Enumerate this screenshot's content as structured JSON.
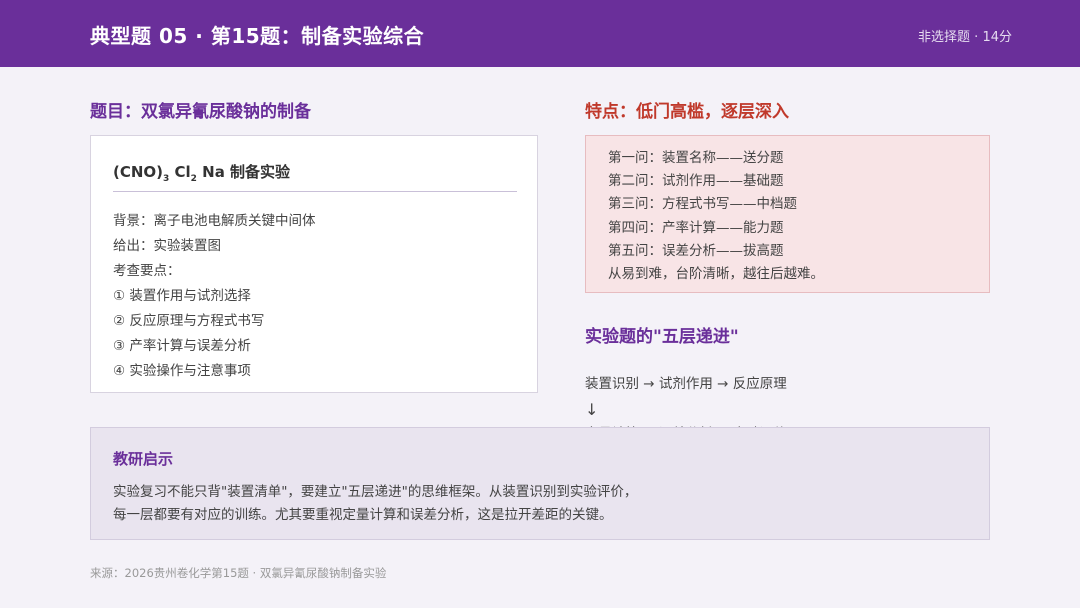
{
  "header": {
    "title": "典型题 05 · 第15题：制备实验综合",
    "meta": "非选择题 · 14分"
  },
  "question": {
    "heading": "题目：双氯异氰尿酸钠的制备",
    "formula_parts": [
      "(CNO)",
      "3",
      " Cl",
      "2",
      " Na 制备实验"
    ],
    "lines": [
      "背景：离子电池电解质关键中间体",
      "给出：实验装置图",
      "考查要点：",
      "① 装置作用与试剂选择",
      "② 反应原理与方程式书写",
      "③ 产率计算与误差分析",
      "④ 实验操作与注意事项"
    ]
  },
  "features": {
    "heading": "特点：低门高槛，逐层深入",
    "lines": [
      "第一问：装置名称——送分题",
      "第二问：试剂作用——基础题",
      "第三问：方程式书写——中档题",
      "第四问：产率计算——能力题",
      "第五问：误差分析——拔高题",
      "从易到难，台阶清晰，越往后越难。"
    ]
  },
  "layers": {
    "heading": "实验题的\"五层递进\"",
    "row1": "装置识别 → 试剂作用 → 反应原理",
    "arrow": "↓",
    "row2": "定量计算 → 误差分析 → 实验评价"
  },
  "insight": {
    "heading": "教研启示",
    "lines": [
      "实验复习不能只背\"装置清单\"，要建立\"五层递进\"的思维框架。从装置识别到实验评价，",
      "每一层都要有对应的训练。尤其要重视定量计算和误差分析，这是拉开差距的关键。"
    ]
  },
  "source": "来源：2026贵州卷化学第15题 · 双氯异氰尿酸钠制备实验"
}
